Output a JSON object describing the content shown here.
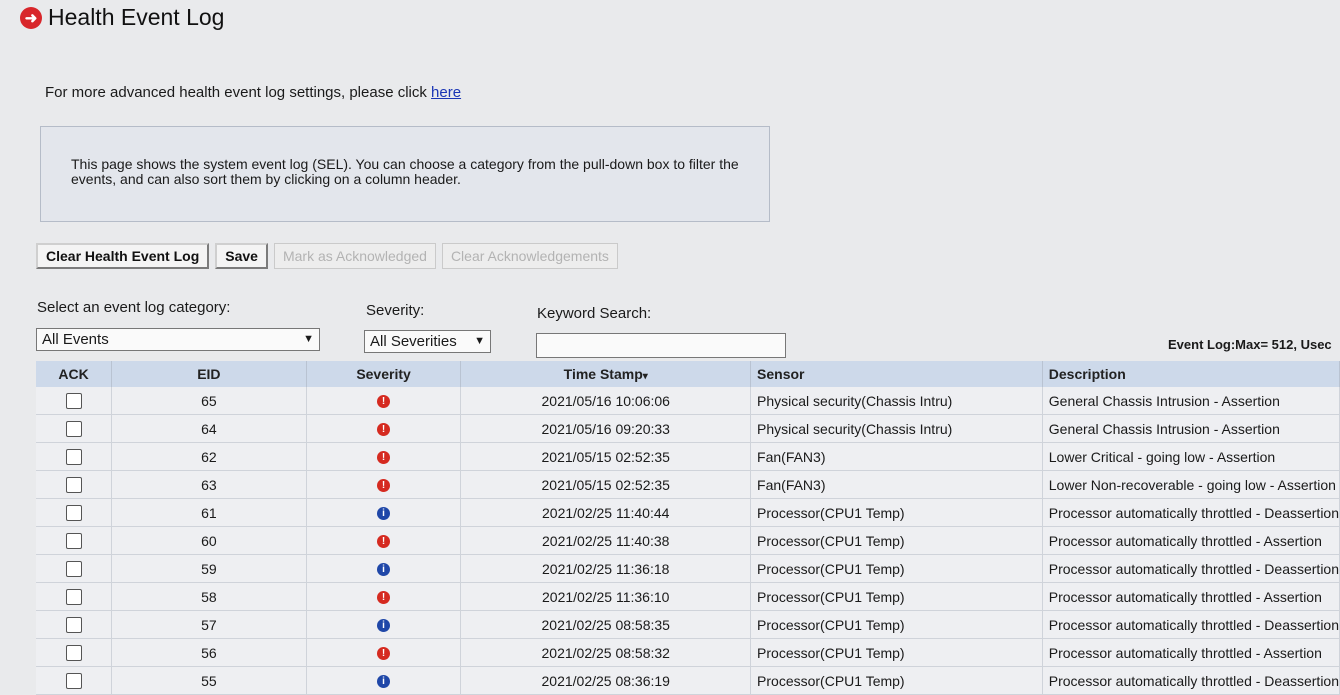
{
  "page": {
    "title": "Health Event Log",
    "advanced_text": "For more advanced health event log settings, please click ",
    "advanced_link": "here",
    "info": "This page shows the system event log (SEL). You can choose a category from the pull-down box to filter the events, and can also sort them by clicking on a column header."
  },
  "buttons": {
    "clear_log": "Clear Health Event Log",
    "save": "Save",
    "mark_ack": "Mark as Acknowledged",
    "clear_ack": "Clear Acknowledgements"
  },
  "filters": {
    "category_label": "Select an event log category:",
    "category_value": "All Events",
    "severity_label": "Severity:",
    "severity_value": "All Severities",
    "keyword_label": "Keyword Search:",
    "keyword_value": ""
  },
  "usage": "Event Log:Max= 512, Usec",
  "table": {
    "headers": {
      "ack": "ACK",
      "eid": "EID",
      "severity": "Severity",
      "timestamp": "Time Stamp",
      "sensor": "Sensor",
      "description": "Description"
    },
    "sort_indicator": "▾",
    "rows": [
      {
        "eid": "65",
        "severity": "critical",
        "icon": "!",
        "timestamp": "2021/05/16 10:06:06",
        "sensor": "Physical security(Chassis Intru)",
        "description": "General Chassis Intrusion - Assertion"
      },
      {
        "eid": "64",
        "severity": "critical",
        "icon": "!",
        "timestamp": "2021/05/16 09:20:33",
        "sensor": "Physical security(Chassis Intru)",
        "description": "General Chassis Intrusion - Assertion"
      },
      {
        "eid": "62",
        "severity": "critical",
        "icon": "!",
        "timestamp": "2021/05/15 02:52:35",
        "sensor": "Fan(FAN3)",
        "description": "Lower Critical - going low - Assertion"
      },
      {
        "eid": "63",
        "severity": "critical",
        "icon": "!",
        "timestamp": "2021/05/15 02:52:35",
        "sensor": "Fan(FAN3)",
        "description": "Lower Non-recoverable - going low - Assertion"
      },
      {
        "eid": "61",
        "severity": "info",
        "icon": "i",
        "timestamp": "2021/02/25 11:40:44",
        "sensor": "Processor(CPU1 Temp)",
        "description": "Processor automatically throttled - Deassertion"
      },
      {
        "eid": "60",
        "severity": "critical",
        "icon": "!",
        "timestamp": "2021/02/25 11:40:38",
        "sensor": "Processor(CPU1 Temp)",
        "description": "Processor automatically throttled - Assertion"
      },
      {
        "eid": "59",
        "severity": "info",
        "icon": "i",
        "timestamp": "2021/02/25 11:36:18",
        "sensor": "Processor(CPU1 Temp)",
        "description": "Processor automatically throttled - Deassertion"
      },
      {
        "eid": "58",
        "severity": "critical",
        "icon": "!",
        "timestamp": "2021/02/25 11:36:10",
        "sensor": "Processor(CPU1 Temp)",
        "description": "Processor automatically throttled - Assertion"
      },
      {
        "eid": "57",
        "severity": "info",
        "icon": "i",
        "timestamp": "2021/02/25 08:58:35",
        "sensor": "Processor(CPU1 Temp)",
        "description": "Processor automatically throttled - Deassertion"
      },
      {
        "eid": "56",
        "severity": "critical",
        "icon": "!",
        "timestamp": "2021/02/25 08:58:32",
        "sensor": "Processor(CPU1 Temp)",
        "description": "Processor automatically throttled - Assertion"
      },
      {
        "eid": "55",
        "severity": "info",
        "icon": "i",
        "timestamp": "2021/02/25 08:36:19",
        "sensor": "Processor(CPU1 Temp)",
        "description": "Processor automatically throttled - Deassertion"
      }
    ]
  }
}
